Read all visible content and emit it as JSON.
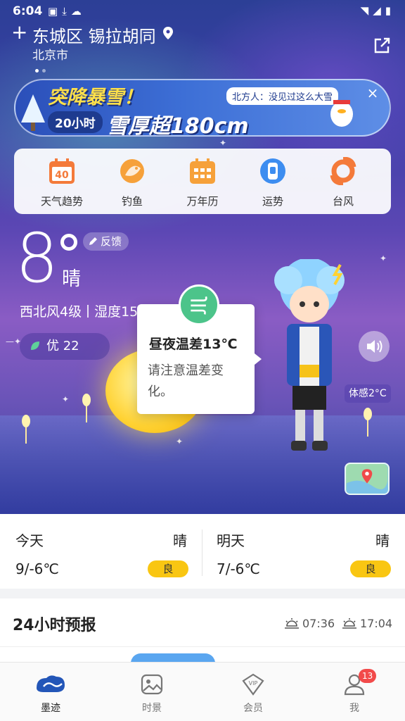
{
  "status_bar": {
    "time": "6:04",
    "left_icons": [
      "image-icon",
      "download-icon",
      "cloud-icon"
    ],
    "right_icons": [
      "wifi-icon",
      "signal-icon",
      "battery-icon"
    ]
  },
  "header": {
    "location": "东城区 锡拉胡同",
    "city": "北京市"
  },
  "banner": {
    "title": "突降暴雪！",
    "hours": "20小时",
    "headline": "雪厚超180cm",
    "tag": "北方人：没见过这么大雪",
    "close": "×"
  },
  "tools": [
    {
      "label": "天气趋势",
      "icon": "calendar-40-icon",
      "badge_text": "40"
    },
    {
      "label": "钓鱼",
      "icon": "fish-icon"
    },
    {
      "label": "万年历",
      "icon": "calendar-grid-icon"
    },
    {
      "label": "运势",
      "icon": "fortune-icon"
    },
    {
      "label": "台风",
      "icon": "typhoon-icon"
    }
  ],
  "current": {
    "temperature": "8",
    "condition": "晴",
    "feedback": "反馈",
    "wind": "西北风4级",
    "humidity": "湿度15%",
    "aqi": "优 22",
    "feels_like": "体感2°C"
  },
  "tooltip": {
    "title": "昼夜温差13℃",
    "body": "请注意温差变化。"
  },
  "days": [
    {
      "name": "今天",
      "condition": "晴",
      "range": "9/-6℃",
      "aqi": "良"
    },
    {
      "name": "明天",
      "condition": "晴",
      "range": "7/-6℃",
      "aqi": "良"
    }
  ],
  "hourly": {
    "title": "24小时预报",
    "sunrise": "07:36",
    "sunset": "17:04"
  },
  "tabs": [
    {
      "label": "墨迹",
      "icon": "moji-logo-icon",
      "active": true
    },
    {
      "label": "时景",
      "icon": "picture-icon",
      "active": false
    },
    {
      "label": "会员",
      "icon": "vip-icon",
      "active": false
    },
    {
      "label": "我",
      "icon": "profile-icon",
      "active": false
    }
  ],
  "profile_badge": "13",
  "colors": {
    "aqi_good": "#f9c612",
    "tooltip_green": "#4cc48a",
    "badge_red": "#f24a4a"
  }
}
